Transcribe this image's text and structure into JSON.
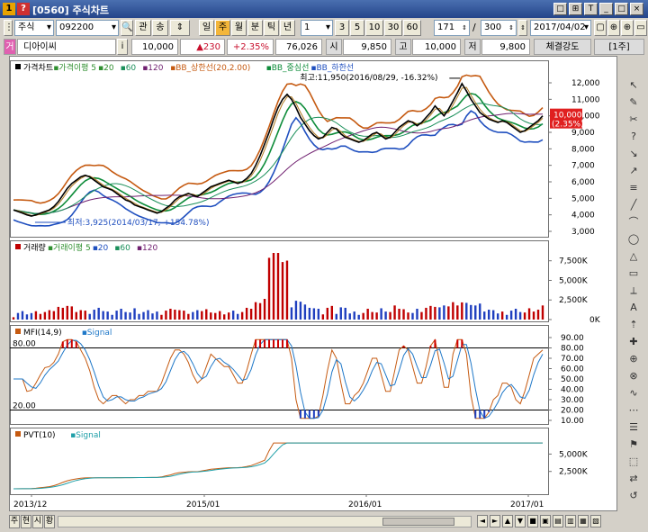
{
  "window": {
    "icon1": "1",
    "icon2": "?",
    "title": "[0560] 주식차트",
    "buttons": [
      "□",
      "⊞",
      "T",
      "_",
      "□",
      "×"
    ]
  },
  "toolbar": {
    "market": "주식",
    "code": "092200",
    "btn_gwan": "관",
    "btn_ok": "송",
    "periods": [
      "일",
      "주",
      "월",
      "분",
      "틱",
      "년"
    ],
    "active_period": "주",
    "interval": "1",
    "quick": [
      "3",
      "5",
      "10",
      "30",
      "60"
    ],
    "count1": "171",
    "count2": "300",
    "date": "2017/04/02",
    "extra": [
      "▢",
      "⊕",
      "⊕",
      "▭"
    ]
  },
  "quote": {
    "badge": "거",
    "name": "디아이씨",
    "info_btn": "i",
    "price": "10,000",
    "change": "▲230",
    "change_pct": "+2.35%",
    "volume": "76,026",
    "open_lbl": "시",
    "open": "9,850",
    "high_lbl": "고",
    "high": "10,000",
    "low_lbl": "저",
    "low": "9,800",
    "strength": "체결강도",
    "unit": "[1주]"
  },
  "legends": {
    "price": [
      {
        "label": "가격차트",
        "color": "#000000"
      },
      {
        "label": "가격이평 5",
        "color": "#2f8f2f"
      },
      {
        "label": "20",
        "color": "#2f8f2f"
      },
      {
        "label": "60",
        "color": "#1a8f5a"
      },
      {
        "label": "120",
        "color": "#702070"
      },
      {
        "label": "BB_상한선(20,2.00)",
        "color": "#c55a11"
      },
      {
        "label": "BB_중심선",
        "color": "#0e8c3a"
      },
      {
        "label": "BB_하한선",
        "color": "#1f4fbf"
      }
    ],
    "volume": [
      {
        "label": "거래량",
        "color": "#c00000"
      },
      {
        "label": "거래이평 5",
        "color": "#2f8f2f"
      },
      {
        "label": "20",
        "color": "#1f4fbf"
      },
      {
        "label": "60",
        "color": "#1a8f5a"
      },
      {
        "label": "120",
        "color": "#702070"
      }
    ],
    "mfi": [
      {
        "label": "MFI(14,9)",
        "color": "#c55a11"
      },
      {
        "label": "Signal",
        "color": "#1f78c8"
      }
    ],
    "pvt": [
      {
        "label": "PVT(10)",
        "color": "#c55a11"
      },
      {
        "label": "Signal",
        "color": "#1f9fa8"
      }
    ]
  },
  "annotations": {
    "high": "최고:11,950(2016/08/29, -16.32%)",
    "low": "최저:3,925(2014/03/17, +154.78%)",
    "last_price": "10,000",
    "last_pct": "(2.35%)",
    "mfi_upper": "80.00",
    "mfi_lower": "20.00"
  },
  "axes": {
    "price_ticks": [
      "12,000",
      "11,000",
      "10,000",
      "9,000",
      "8,000",
      "7,000",
      "6,000",
      "5,000",
      "4,000",
      "3,000"
    ],
    "volume_ticks": [
      "7,500K",
      "5,000K",
      "2,500K",
      "0K"
    ],
    "mfi_ticks": [
      "90.00",
      "80.00",
      "70.00",
      "60.00",
      "50.00",
      "40.00",
      "30.00",
      "20.00",
      "10.00"
    ],
    "pvt_ticks": [
      "5,000K",
      "2,500K"
    ],
    "x_labels": [
      "2013/12",
      "2015/01",
      "2016/01",
      "2017/01"
    ]
  },
  "bottom": {
    "tabs": [
      "주",
      "현",
      "시",
      "황"
    ],
    "controls": [
      "◄",
      "►",
      "▲",
      "▼",
      "■",
      "▣",
      "▤",
      "▥",
      "▦",
      "▧"
    ]
  },
  "right_tools": [
    "↖",
    "✎",
    "✂",
    "?",
    "↘",
    "↗",
    "≡",
    "╱",
    "⌒",
    "◯",
    "△",
    "▭",
    "⟂",
    "A",
    "⇡",
    "✚",
    "⊕",
    "⊗",
    "∿",
    "⋯",
    "☰",
    "⚑",
    "⬚",
    "⇄",
    "↺"
  ],
  "chart_data": {
    "type": "line",
    "x_range": [
      "2013/12",
      "2017/04"
    ],
    "price_range": [
      3000,
      12600
    ],
    "price_weekly": [
      4300,
      4200,
      4100,
      4000,
      3925,
      4000,
      4100,
      4200,
      4300,
      4500,
      4800,
      5200,
      5600,
      5900,
      6100,
      6300,
      6400,
      6300,
      6100,
      5900,
      5700,
      5600,
      5500,
      5300,
      5100,
      4900,
      4800,
      4600,
      4500,
      4400,
      4300,
      4200,
      4100,
      4200,
      4400,
      4600,
      4900,
      5100,
      5200,
      5300,
      5200,
      5100,
      5300,
      5500,
      5700,
      5800,
      5900,
      6000,
      6100,
      6000,
      5900,
      6000,
      6200,
      6500,
      7000,
      7600,
      8300,
      9000,
      9800,
      10500,
      11000,
      11300,
      11000,
      10500,
      9900,
      9500,
      9100,
      8800,
      8600,
      8700,
      9000,
      9300,
      9200,
      8900,
      8700,
      8600,
      8500,
      8400,
      8500,
      8700,
      8900,
      9000,
      8800,
      8600,
      8700,
      9000,
      9300,
      9500,
      9700,
      9600,
      9400,
      9600,
      9900,
      10200,
      10600,
      10300,
      10000,
      10400,
      10900,
      11400,
      11950,
      11500,
      11000,
      10600,
      10200,
      10000,
      9800,
      9700,
      9600,
      9700,
      9600,
      9400,
      9200,
      9000,
      9100,
      9300,
      9500,
      9700,
      10000
    ],
    "mfi_range": [
      10,
      90
    ],
    "volume_max_k": 8500
  }
}
